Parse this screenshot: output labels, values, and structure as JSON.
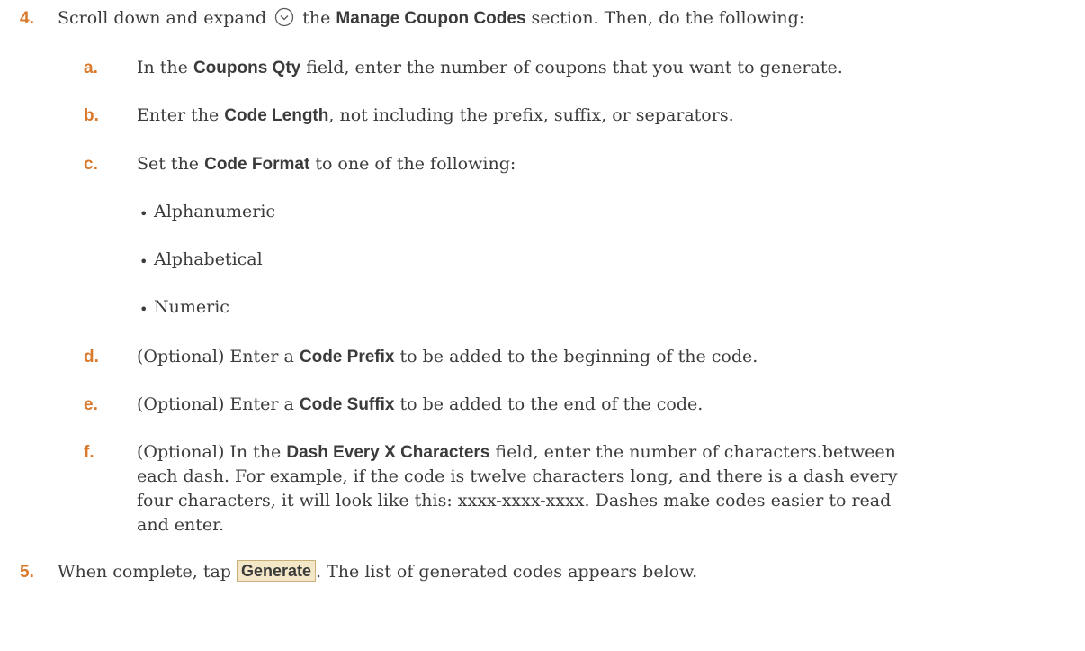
{
  "step4": {
    "number": "4.",
    "text_before_icon": "Scroll down and expand",
    "icon": "chevron-circle-down-icon",
    "text_after_icon": " the ",
    "bold": "Manage Coupon Codes",
    "text_end": " section. Then, do the following:"
  },
  "substeps": {
    "a": {
      "letter": "a.",
      "pre": "In the ",
      "bold": "Coupons Qty",
      "post": " field, enter the number of coupons that you want to generate."
    },
    "b": {
      "letter": "b.",
      "pre": "Enter the ",
      "bold": "Code Length",
      "post": ", not including the prefix, suffix, or separators."
    },
    "c": {
      "letter": "c.",
      "pre": "Set the ",
      "bold": "Code Format",
      "post": " to one of the following:",
      "options": [
        "Alphanumeric",
        "Alphabetical",
        "Numeric"
      ]
    },
    "d": {
      "letter": "d.",
      "pre": "(Optional) Enter a ",
      "bold": "Code Prefix",
      "post": " to be added to the beginning of the code."
    },
    "e": {
      "letter": "e.",
      "pre": "(Optional) Enter a ",
      "bold": "Code Suffix",
      "post": " to be added to the end of the code."
    },
    "f": {
      "letter": "f.",
      "pre": "(Optional) In the ",
      "bold": "Dash Every X Characters",
      "post_line1": " field, enter the number of characters.between",
      "line2": "each dash. For example, if the code is twelve characters long, and there is a dash every",
      "line3": "four characters, it will look like this: xxxx-xxxx-xxxx. Dashes make codes easier to read",
      "line4": "and enter."
    }
  },
  "step5": {
    "number": "5.",
    "pre": "When complete, tap ",
    "button_label": "Generate",
    "post": ". The list of generated codes appears below."
  },
  "colors": {
    "accent": "#d8792b",
    "text": "#3b3b3b",
    "button_bg": "#f4e7c8",
    "button_border": "#c9b07a"
  }
}
